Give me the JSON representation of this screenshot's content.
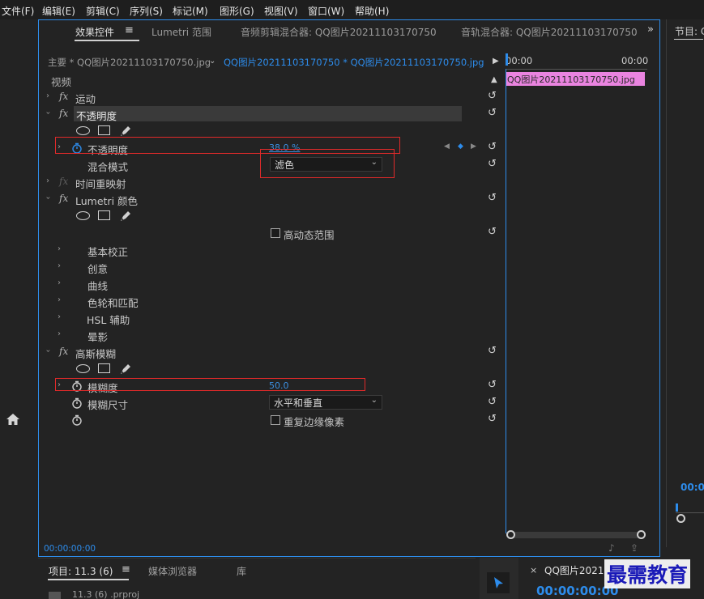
{
  "menu": [
    "文件(F)",
    "编辑(E)",
    "剪辑(C)",
    "序列(S)",
    "标记(M)",
    "图形(G)",
    "视图(V)",
    "窗口(W)",
    "帮助(H)"
  ],
  "tabs": {
    "effect_controls": "效果控件",
    "lumetri_scopes": "Lumetri 范围",
    "audio_clip_mixer": "音频剪辑混合器: QQ图片20211103170750",
    "audio_track_mixer": "音轨混合器: QQ图片20211103170750",
    "program": "节目: C"
  },
  "source": {
    "master": "主要 * QQ图片20211103170750.jpg",
    "clip": "QQ图片20211103170750 * QQ图片20211103170750.jpg"
  },
  "timeline": {
    "t_start": "00:00",
    "t_end": "00:00",
    "clip_name": "QQ图片20211103170750.jpg"
  },
  "effects": {
    "video_header": "视频",
    "motion": "运动",
    "opacity": "不透明度",
    "opacity_param": "不透明度",
    "opacity_value": "38.0 %",
    "blend_mode_label": "混合模式",
    "blend_mode_value": "滤色",
    "time_remap": "时间重映射",
    "lumetri": "Lumetri 颜色",
    "hdr": "高动态范围",
    "basic": "基本校正",
    "creative": "创意",
    "curves": "曲线",
    "wheels": "色轮和匹配",
    "hsl": "HSL 辅助",
    "vignette": "晕影",
    "gaussian": "高斯模糊",
    "blurriness": "模糊度",
    "blurriness_value": "50.0",
    "blur_dims_label": "模糊尺寸",
    "blur_dims_value": "水平和垂直",
    "repeat_edge": "重复边缘像素"
  },
  "timecode_bottom": "00:00:00:00",
  "program_tc": "00:0",
  "project": {
    "tab_project": "项目: 11.3 (6)",
    "tab_media": "媒体浏览器",
    "tab_library": "库",
    "file": "11.3 (6) .prproj"
  },
  "timeline_panel": {
    "title": "QQ图片2021",
    "timecode": "00:00:00:00"
  },
  "watermark": "最需教育",
  "colors": {
    "accent": "#2d8ceb",
    "clip": "#ea84e0",
    "highlight_box": "#e02a2a"
  }
}
